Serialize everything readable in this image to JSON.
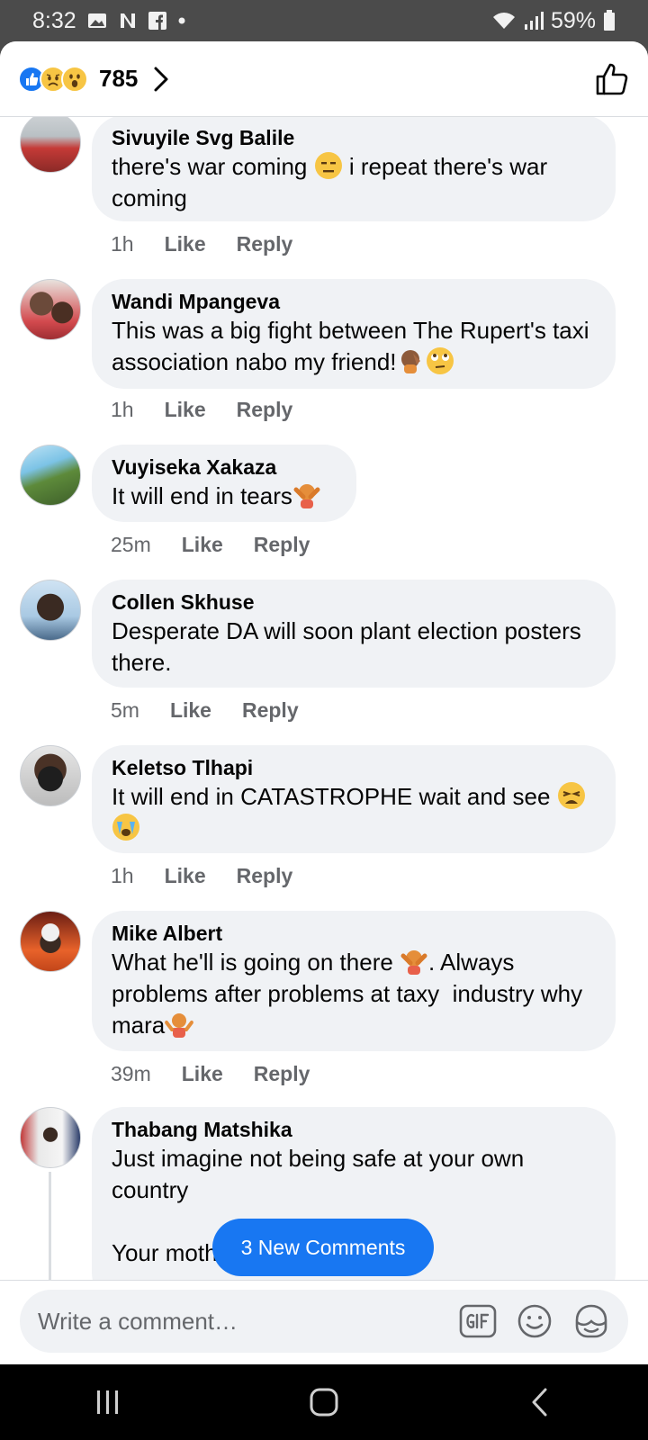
{
  "status_bar": {
    "time": "8:32",
    "battery": "59%"
  },
  "header": {
    "reaction_count": "785"
  },
  "comments": [
    {
      "author": "Sivuyile Svg Balile",
      "text": "there's war coming",
      "text_after": "i repeat there's war coming",
      "time": "1h",
      "like": "Like",
      "reply": "Reply"
    },
    {
      "author": "Wandi Mpangeva",
      "text": "This was a big fight between The Rupert's taxi association nabo my friend!",
      "time": "1h",
      "like": "Like",
      "reply": "Reply"
    },
    {
      "author": "Vuyiseka Xakaza",
      "text": "It will end in tears",
      "time": "25m",
      "like": "Like",
      "reply": "Reply"
    },
    {
      "author": "Collen Skhuse",
      "text": "Desperate DA will soon plant election posters there.",
      "time": "5m",
      "like": "Like",
      "reply": "Reply"
    },
    {
      "author": "Keletso Tlhapi",
      "text": "It will end in CATASTROPHE wait and see",
      "time": "1h",
      "like": "Like",
      "reply": "Reply"
    },
    {
      "author": "Mike Albert",
      "text": "What he'll is going on there",
      "text_after": ". Always problems after problems at taxy  industry why mara",
      "time": "39m",
      "like": "Like",
      "reply": "Reply"
    },
    {
      "author": "Thabang Matshika",
      "text": "Just imagine not being safe at your own country\n\nYour motherland"
    }
  ],
  "new_comments_label": "3 New Comments",
  "composer": {
    "placeholder": "Write a comment…"
  },
  "colors": {
    "accent": "#1877f2",
    "bubble": "#f0f2f5",
    "meta": "#65676b"
  },
  "icons": [
    "photo-icon",
    "netflix-icon",
    "facebook-icon",
    "wifi-icon",
    "signal-icon",
    "battery-icon",
    "like-reaction-icon",
    "sad-reaction-icon",
    "wow-reaction-icon",
    "chevron-right-icon",
    "thumbs-up-icon",
    "gif-icon",
    "emoji-icon",
    "sticker-icon",
    "recents-icon",
    "home-icon",
    "back-icon"
  ]
}
